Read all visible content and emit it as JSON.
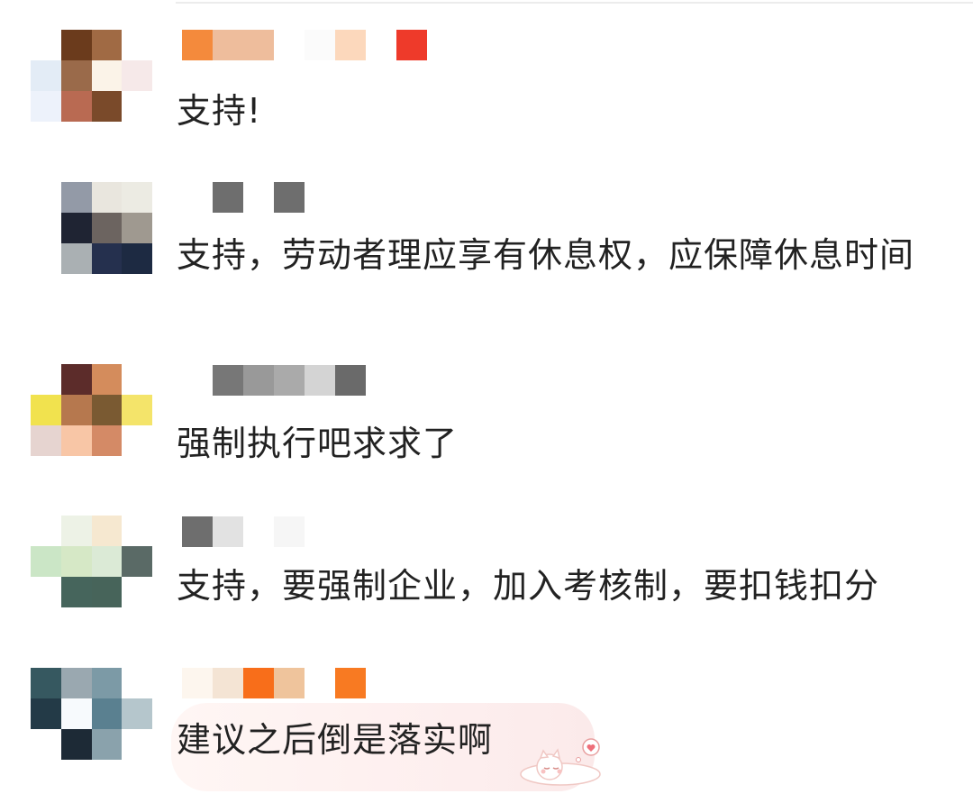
{
  "comments": [
    {
      "text": "支持!",
      "avatar_colors": [
        "#ffffff",
        "#6b3b1c",
        "#a06a44",
        "#ffffff",
        "#e3ecf6",
        "#9a6a4a",
        "#fbf3e8",
        "#f6e9e9",
        "#edf2fb",
        "#b96a52",
        "#7a4a2a",
        "#ffffff"
      ],
      "username_colors": [
        "#f48a3c",
        "#eebd9c",
        "#eebd9c",
        "#ffffff",
        "#fbfbfb",
        "#fcd8bc",
        "#ffffff",
        "#ee3a2a"
      ]
    },
    {
      "text": "支持，劳动者理应享有休息权，应保障休息时间",
      "avatar_colors": [
        "#ffffff",
        "#939aa7",
        "#e9e6de",
        "#ecebe3",
        "#ffffff",
        "#1f2433",
        "#6c6460",
        "#9f9990",
        "#ffffff",
        "#aab0b3",
        "#25304e",
        "#1d2a42"
      ],
      "username_colors": [
        "#ffffff",
        "#6e6e6e",
        "#ffffff",
        "#6e6e6e",
        "#ffffff"
      ]
    },
    {
      "text": "强制执行吧求求了",
      "avatar_colors": [
        "#ffffff",
        "#5c2c2a",
        "#d48c5c",
        "#ffffff",
        "#f1e24e",
        "#b6784e",
        "#7a5a32",
        "#f4e46a",
        "#e6d4d0",
        "#f8c6a6",
        "#d48a66",
        "#ffffff"
      ],
      "username_colors": [
        "#777777",
        "#999999",
        "#aaaaaa",
        "#d4d4d4",
        "#6a6a6a"
      ]
    },
    {
      "text": "支持，要强制企业，加入考核制，要扣钱扣分",
      "avatar_colors": [
        "#ffffff",
        "#edf2e6",
        "#f6e8d0",
        "#ffffff",
        "#cbe6c6",
        "#d6e8c6",
        "#dbead6",
        "#5a6a66",
        "#ffffff",
        "#46655c",
        "#47645a",
        "#ffffff"
      ],
      "username_colors": [
        "#6e6e6e",
        "#e2e2e2",
        "#ffffff",
        "#f6f6f6"
      ]
    },
    {
      "text": "建议之后倒是落实啊",
      "avatar_colors": [
        "#365860",
        "#9aa8b0",
        "#7c9aa6",
        "#ffffff",
        "#233a47",
        "#f7fafd",
        "#5a8090",
        "#b5c6cc",
        "#ffffff",
        "#1d2a36",
        "#8aa2ac",
        "#ffffff"
      ],
      "username_colors": [
        "#fdf6ee",
        "#f4e4d4",
        "#f86e1a",
        "#efc49c",
        "#ffffff",
        "#f87a22"
      ]
    }
  ],
  "sticker_icon": "sleeping-cat-heart-icon"
}
